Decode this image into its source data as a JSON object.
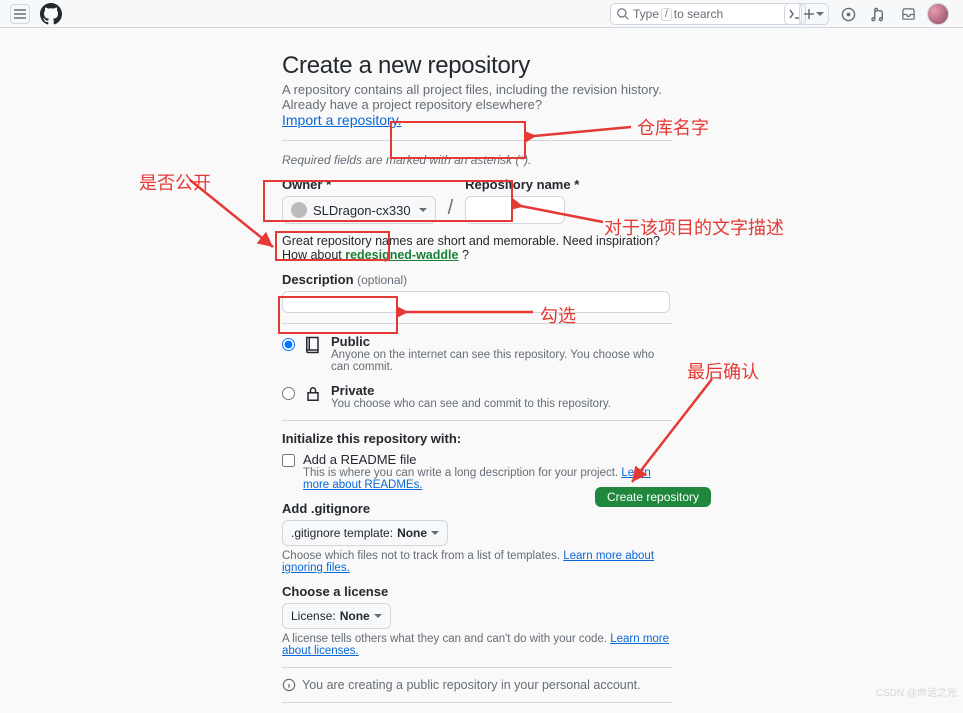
{
  "header": {
    "search_placeholder": "Type / to search",
    "search_prefix": "Type",
    "search_key": "/",
    "search_suffix": "to search"
  },
  "page": {
    "title": "Create a new repository",
    "subtitle": "A repository contains all project files, including the revision history. Already have a project repository elsewhere?",
    "import_link": "Import a repository.",
    "required_note": "Required fields are marked with an asterisk (*).",
    "owner_label": "Owner *",
    "owner_value": "SLDragon-cx330",
    "slash": "/",
    "repo_label": "Repository name *",
    "name_hint_prefix": "Great repository names are short and memorable. Need inspiration? How about ",
    "name_hint_suggestion": "redesigned-waddle",
    "name_hint_suffix": " ?",
    "desc_label": "Description",
    "desc_optional": "(optional)",
    "public_title": "Public",
    "public_sub": "Anyone on the internet can see this repository. You choose who can commit.",
    "private_title": "Private",
    "private_sub": "You choose who can see and commit to this repository.",
    "init_title": "Initialize this repository with:",
    "readme_label": "Add a README file",
    "readme_sub": "This is where you can write a long description for your project. ",
    "readme_link": "Learn more about READMEs.",
    "gitignore_title": "Add .gitignore",
    "gitignore_sel_prefix": ".gitignore template:",
    "gitignore_sel_value": "None",
    "gitignore_hint": "Choose which files not to track from a list of templates. ",
    "gitignore_link": "Learn more about ignoring files.",
    "license_title": "Choose a license",
    "license_sel_prefix": "License:",
    "license_sel_value": "None",
    "license_hint": "A license tells others what they can and can't do with your code. ",
    "license_link": "Learn more about licenses.",
    "info_text": "You are creating a public repository in your personal account.",
    "create_btn": "Create repository"
  },
  "annotations": {
    "a1": "仓库名字",
    "a2": "是否公开",
    "a3": "对于该项目的文字描述",
    "a4": "勾选",
    "a5": "最后确认"
  },
  "watermark": "CSDN @命运之光"
}
